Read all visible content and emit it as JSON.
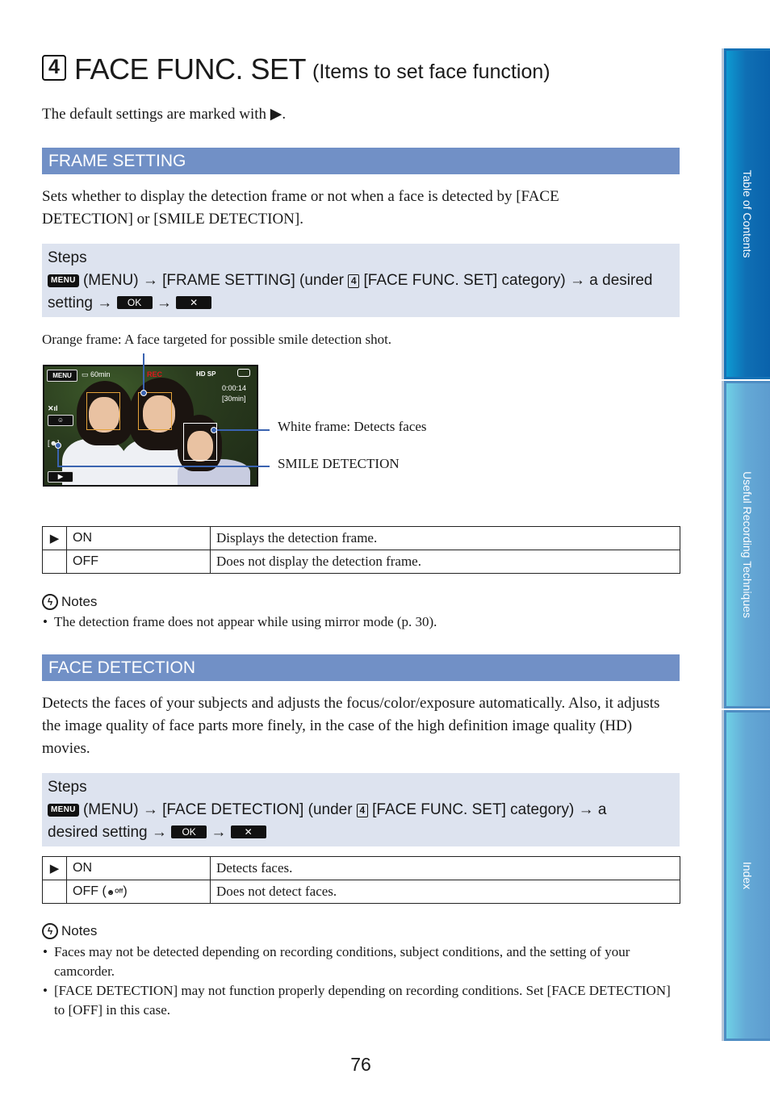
{
  "header": {
    "category_number": "4",
    "title": "FACE FUNC. SET",
    "subtitle": "(Items to set face function)",
    "default_note": "The default settings are marked with ▶."
  },
  "sections": [
    {
      "heading": "FRAME SETTING",
      "description": "Sets whether to display the detection frame or not when a face is detected by [FACE DETECTION] or [SMILE DETECTION].",
      "steps": {
        "label": "Steps",
        "menu_key": "MENU",
        "part1": "(MENU) → [FRAME SETTING] (under",
        "category": "4",
        "part2": "[FACE FUNC. SET] category) → a desired setting →",
        "ok_key": "OK",
        "arrow": "→",
        "close_key": "✕"
      },
      "caption": "Orange frame: A face targeted for possible smile detection shot.",
      "figure": {
        "menu_button": "MENU",
        "battery": "60min",
        "rec": "REC",
        "quality": "HD SP",
        "timecode": "0:00:14",
        "remaining": "[30min]",
        "callouts": [
          "White frame: Detects faces",
          "SMILE DETECTION"
        ]
      },
      "options": [
        {
          "default": true,
          "marker": "▶",
          "name": "ON",
          "description": "Displays the detection frame."
        },
        {
          "default": false,
          "marker": "",
          "name": "OFF",
          "description": "Does not display the detection frame."
        }
      ],
      "notes": {
        "label": "Notes",
        "items": [
          "The detection frame does not appear while using mirror mode (p. 30)."
        ]
      }
    },
    {
      "heading": "FACE DETECTION",
      "description": "Detects the faces of your subjects and adjusts the focus/color/exposure automatically. Also, it adjusts the image quality of face parts more finely, in the case of the high definition image quality (HD) movies.",
      "steps": {
        "label": "Steps",
        "menu_key": "MENU",
        "part1": "(MENU) → [FACE DETECTION] (under",
        "category": "4",
        "part2": "[FACE FUNC. SET] category) → a desired setting →",
        "ok_key": "OK",
        "arrow": "→",
        "close_key": "✕"
      },
      "options": [
        {
          "default": true,
          "marker": "▶",
          "name": "ON",
          "description": "Detects faces."
        },
        {
          "default": false,
          "marker": "",
          "name": "OFF (",
          "icon": "face-off-icon",
          "name_end": ")",
          "description": "Does not detect faces."
        }
      ],
      "notes": {
        "label": "Notes",
        "items": [
          "Faces may not be detected depending on recording conditions, subject conditions, and the setting of your camcorder.",
          "[FACE DETECTION] may not function properly depending on recording conditions. Set [FACE DETECTION] to [OFF] in this case."
        ]
      }
    }
  ],
  "side_tabs": [
    {
      "label": "Table of Contents",
      "active": true
    },
    {
      "label": "Useful Recording Techniques",
      "active": false
    },
    {
      "label": "Index",
      "active": false
    }
  ],
  "page_number": "76",
  "colors": {
    "section_bar": "#7190c6",
    "steps_bg": "#dde3ef",
    "tab_active": "#0f6fb4",
    "tab_inactive": "#64a9d6",
    "frame_orange": "#e5a33a",
    "callout_blue": "#3a63b0"
  }
}
